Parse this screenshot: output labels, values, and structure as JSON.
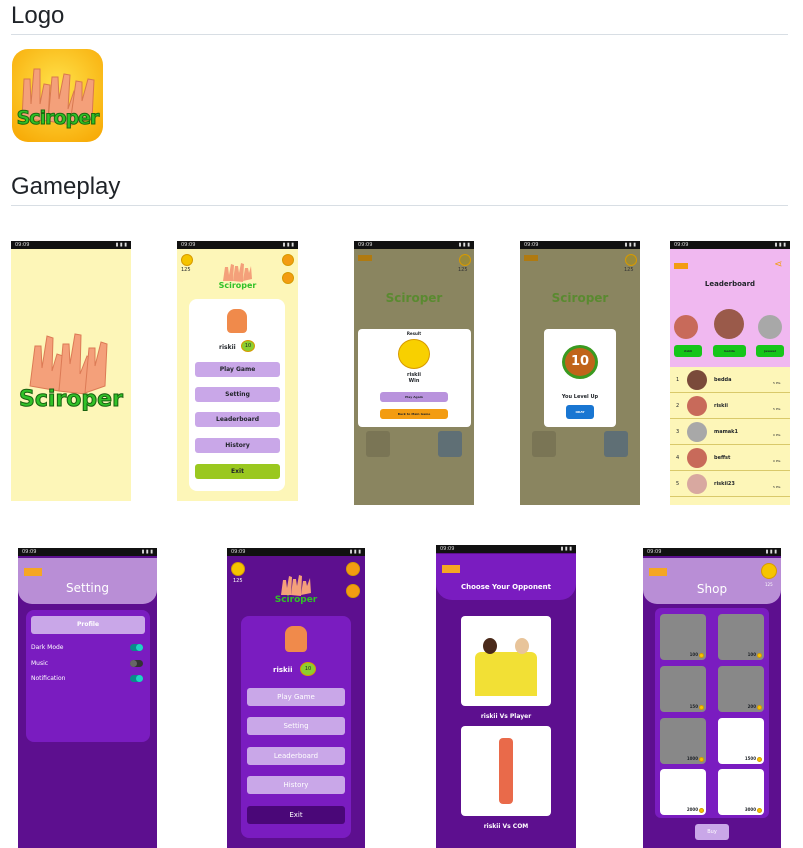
{
  "sections": {
    "logo": "Logo",
    "gameplay": "Gameplay"
  },
  "status": {
    "time": "09:09"
  },
  "app": {
    "name": "Sciroper",
    "coins": "125",
    "user": "riskii",
    "level": "10"
  },
  "menu": {
    "play": "Play Game",
    "setting": "Setting",
    "leaderboard": "Leaderboard",
    "history": "History",
    "exit": "Exit"
  },
  "result": {
    "title": "Result",
    "winner": "riskii",
    "win": "Win",
    "play_again": "Play Again",
    "back": "Back to Main Game"
  },
  "levelup": {
    "level": "10",
    "text": "You Level Up",
    "ok": "OKAY"
  },
  "leaderboard": {
    "title": "Leaderboard",
    "top": [
      {
        "name": "riskii"
      },
      {
        "name": "bedda"
      },
      {
        "name": "jawwel"
      }
    ],
    "rows": [
      {
        "rank": "1",
        "name": "bedda",
        "pts": "5 Pts"
      },
      {
        "rank": "2",
        "name": "riskii",
        "pts": "5 Pts"
      },
      {
        "rank": "3",
        "name": "mamak1",
        "pts": "0 Pts"
      },
      {
        "rank": "4",
        "name": "beffst",
        "pts": "0 Pts"
      },
      {
        "rank": "5",
        "name": "riskii23",
        "pts": "5 Pts"
      }
    ]
  },
  "setting": {
    "title": "Setting",
    "profile": "Profile",
    "dark": "Dark Mode",
    "music": "Music",
    "notif": "Notification"
  },
  "opponent": {
    "title": "Choose Your Opponent",
    "vs_player": "riskii Vs Player",
    "vs_com": "riskii Vs COM"
  },
  "shop": {
    "title": "Shop",
    "coins": "125",
    "buy": "Buy",
    "prices": [
      "100",
      "100",
      "150",
      "200",
      "1000",
      "1500",
      "2000",
      "3000"
    ]
  },
  "colors": {
    "cream": "#fdf6b8",
    "purple": "#5d0f8f",
    "lilac": "#c9a7e8",
    "green": "#16c51a",
    "orange": "#f5a623",
    "yellow": "#f5c400"
  }
}
